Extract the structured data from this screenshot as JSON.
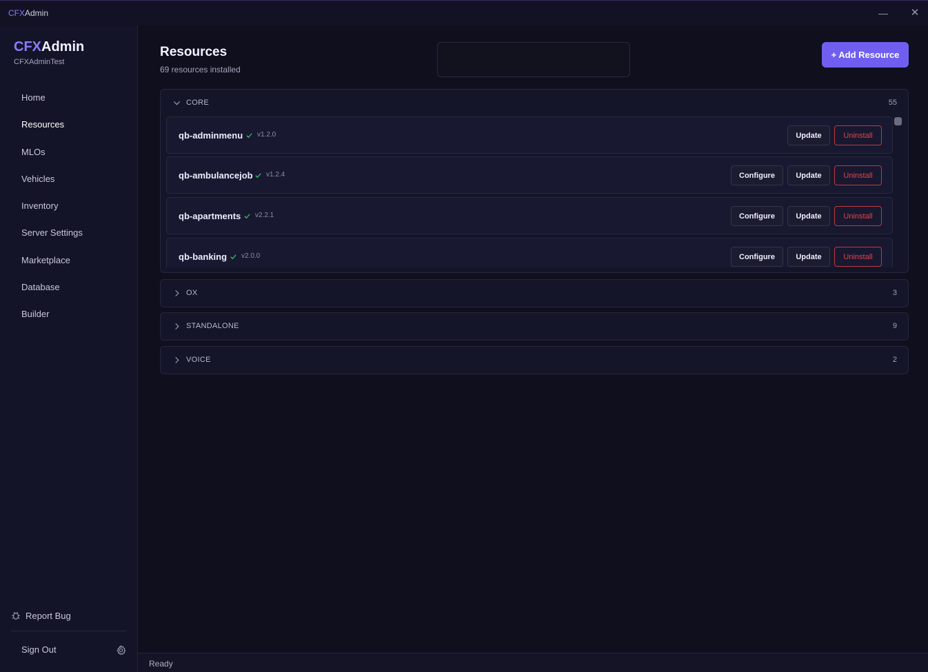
{
  "window": {
    "title_accent": "CFX",
    "title_rest": "Admin",
    "minimize": "—",
    "close": "✕"
  },
  "sidebar": {
    "brand_accent": "CFX",
    "brand_rest": "Admin",
    "server_name": "CFXAdminTest",
    "items": [
      {
        "label": "Home"
      },
      {
        "label": "Resources"
      },
      {
        "label": "MLOs"
      },
      {
        "label": "Vehicles"
      },
      {
        "label": "Inventory"
      },
      {
        "label": "Server Settings"
      },
      {
        "label": "Marketplace"
      },
      {
        "label": "Database"
      },
      {
        "label": "Builder"
      }
    ],
    "active": "Resources",
    "report_bug": "Report Bug",
    "sign_out": "Sign Out"
  },
  "main": {
    "title": "Resources",
    "subtitle": "69 resources installed",
    "search_placeholder": "",
    "add_button": "+ Add Resource",
    "groups": [
      {
        "name": "CORE",
        "count": "55",
        "expanded": true,
        "resources": [
          {
            "name": "qb-adminmenu",
            "version": "v1.2.0",
            "configure": false
          },
          {
            "name": "qb-ambulancejob",
            "version": "v1.2.4",
            "configure": true
          },
          {
            "name": "qb-apartments",
            "version": "v2.2.1",
            "configure": true
          },
          {
            "name": "qb-banking",
            "version": "v2.0.0",
            "configure": true
          }
        ]
      },
      {
        "name": "OX",
        "count": "3",
        "expanded": false
      },
      {
        "name": "STANDALONE",
        "count": "9",
        "expanded": false
      },
      {
        "name": "VOICE",
        "count": "2",
        "expanded": false
      }
    ],
    "button_labels": {
      "configure": "Configure",
      "update": "Update",
      "uninstall": "Uninstall"
    }
  },
  "status": {
    "text": "Ready"
  },
  "colors": {
    "accent": "#6f5ef0",
    "danger": "#e2464a",
    "success": "#3fbf6a"
  }
}
